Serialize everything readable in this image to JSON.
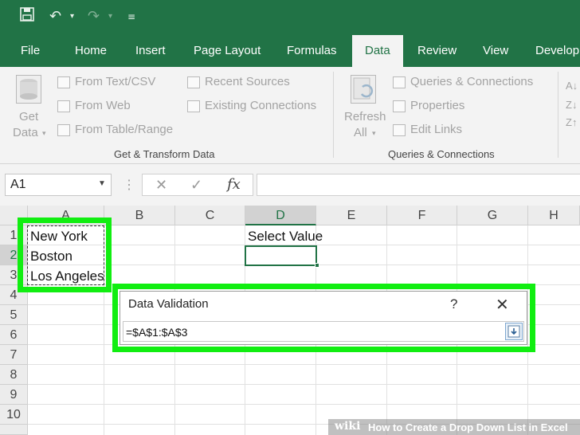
{
  "quick_access": {
    "save_icon": "save-icon",
    "undo_icon": "undo-icon",
    "redo_icon": "redo-icon",
    "customize_icon": "customize-icon"
  },
  "tabs": [
    {
      "label": "File"
    },
    {
      "label": "Home"
    },
    {
      "label": "Insert"
    },
    {
      "label": "Page Layout"
    },
    {
      "label": "Formulas"
    },
    {
      "label": "Data",
      "active": true
    },
    {
      "label": "Review"
    },
    {
      "label": "View"
    },
    {
      "label": "Develop"
    }
  ],
  "ribbon": {
    "get_data_line1": "Get",
    "get_data_line2": "Data",
    "from_text": "From Text/CSV",
    "from_web": "From Web",
    "from_table": "From Table/Range",
    "recent_sources": "Recent Sources",
    "existing_connections": "Existing Connections",
    "group1_label": "Get & Transform Data",
    "refresh_line1": "Refresh",
    "refresh_line2": "All",
    "queries_connections": "Queries & Connections",
    "properties": "Properties",
    "edit_links": "Edit Links",
    "group2_label": "Queries & Connections"
  },
  "formula_bar": {
    "name_box": "A1",
    "cancel": "✕",
    "enter": "✓",
    "fx": "fx",
    "value": ""
  },
  "sheet": {
    "columns": [
      "A",
      "B",
      "C",
      "D",
      "E",
      "F",
      "G",
      "H"
    ],
    "selected_column": "D",
    "rows": [
      "1",
      "2",
      "3",
      "4",
      "5",
      "6",
      "7",
      "8",
      "9",
      "10"
    ],
    "selected_row": "2",
    "cells": {
      "A1": "New York",
      "A2": "Boston",
      "A3": "Los Angeles",
      "D1": "Select Value"
    }
  },
  "dialog": {
    "title": "Data Validation",
    "help": "?",
    "close": "✕",
    "source_value": "=$A$1:$A$3"
  },
  "watermark": {
    "wiki": "wiki",
    "text": "How to Create a Drop Down List in Excel"
  },
  "colors": {
    "excel_green": "#217346",
    "highlight_green": "#11ee11"
  }
}
